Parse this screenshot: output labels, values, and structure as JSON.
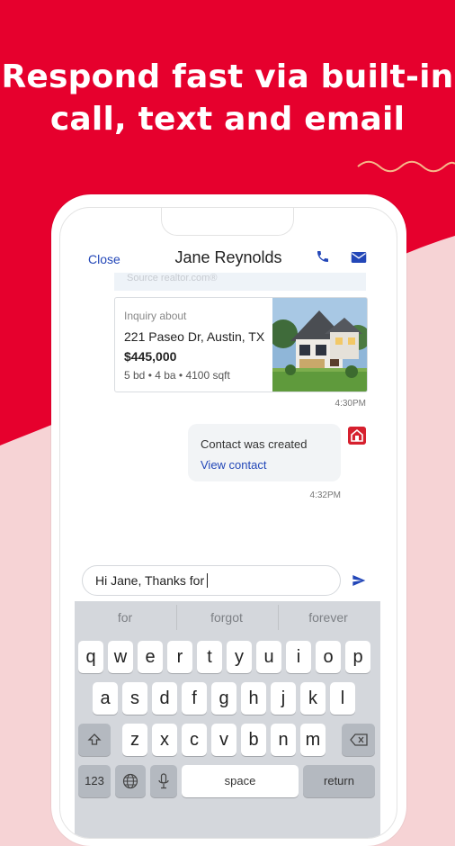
{
  "headline": {
    "line1": "Respond fast via built-in",
    "line2": "call, text and email"
  },
  "colors": {
    "brand_red": "#e6002d",
    "pink_bg": "#f6d3d5",
    "link_blue": "#2347b8"
  },
  "chat": {
    "close_label": "Close",
    "contact_name": "Jane Reynolds",
    "icons": [
      "phone-icon",
      "mail-icon"
    ],
    "source_text": "Source realtor.com®",
    "inquiry": {
      "label": "Inquiry about",
      "address": "221 Paseo Dr, Austin, TX",
      "price": "$445,000",
      "details": "5 bd • 4 ba • 4100 sqft",
      "time": "4:30PM"
    },
    "contact_bubble": {
      "text": "Contact was created",
      "link": "View contact",
      "time": "4:32PM"
    },
    "composer_text": "Hi Jane, Thanks for"
  },
  "keyboard": {
    "suggestions": [
      "for",
      "forgot",
      "forever"
    ],
    "row1": [
      "q",
      "w",
      "e",
      "r",
      "t",
      "y",
      "u",
      "i",
      "o",
      "p"
    ],
    "row2": [
      "a",
      "s",
      "d",
      "f",
      "g",
      "h",
      "j",
      "k",
      "l"
    ],
    "row3": [
      "z",
      "x",
      "c",
      "v",
      "b",
      "n",
      "m"
    ],
    "numbers_label": "123",
    "space_label": "space",
    "return_label": "return"
  }
}
